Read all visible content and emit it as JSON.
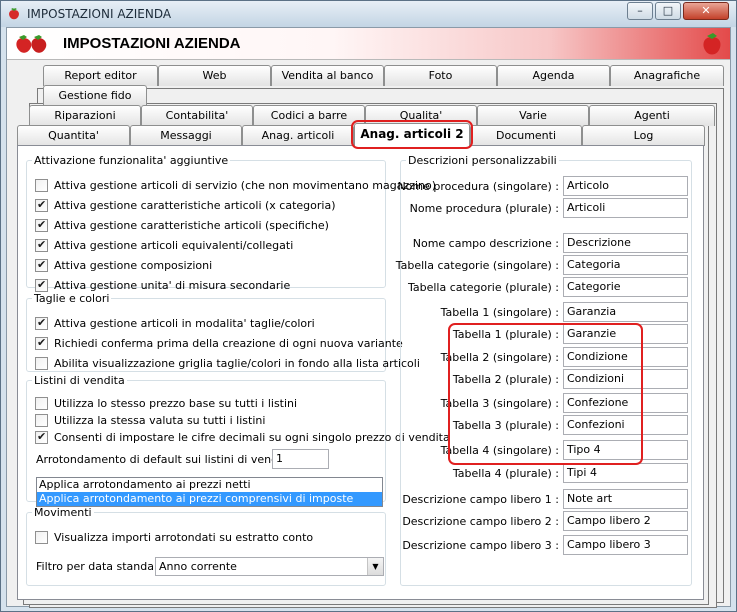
{
  "window": {
    "title": "IMPOSTAZIONI AZIENDA",
    "minimize_glyph": "–",
    "maximize_glyph": "□",
    "close_glyph": "✕"
  },
  "header": {
    "title": "IMPOSTAZIONI AZIENDA",
    "logo_icon": "strawberry-icon"
  },
  "tabs": {
    "row1": [
      "Report editor",
      "Web",
      "Vendita al banco",
      "Foto",
      "Agenda",
      "Anagrafiche"
    ],
    "row2": [
      "Gestione fido"
    ],
    "row3": [
      "Riparazioni",
      "Contabilita'",
      "Codici a barre",
      "Qualita'",
      "Varie",
      "Agenti"
    ],
    "row4": [
      "Quantita'",
      "Messaggi",
      "Anag. articoli",
      "Anag. articoli 2",
      "Documenti",
      "Log"
    ],
    "active": "Anag. articoli 2"
  },
  "attivazione": {
    "legend": "Attivazione funzionalita' aggiuntive",
    "items": [
      {
        "label": "Attiva gestione articoli di servizio (che non movimentano magazzino)",
        "checked": false
      },
      {
        "label": "Attiva gestione caratteristiche articoli (x categoria)",
        "checked": true
      },
      {
        "label": "Attiva gestione caratteristiche articoli (specifiche)",
        "checked": true
      },
      {
        "label": "Attiva gestione articoli equivalenti/collegati",
        "checked": true
      },
      {
        "label": "Attiva gestione composizioni",
        "checked": true
      },
      {
        "label": "Attiva gestione unita' di misura secondarie",
        "checked": true
      }
    ]
  },
  "taglie": {
    "legend": "Taglie e colori",
    "items": [
      {
        "label": "Attiva gestione articoli in modalita' taglie/colori",
        "checked": true
      },
      {
        "label": "Richiedi conferma prima della creazione di ogni nuova variante",
        "checked": true
      },
      {
        "label": "Abilita visualizzazione griglia taglie/colori in fondo alla lista articoli",
        "checked": false
      }
    ]
  },
  "listini": {
    "legend": "Listini di vendita",
    "items": [
      {
        "label": "Utilizza lo stesso prezzo base su tutti i listini",
        "checked": false
      },
      {
        "label": "Utilizza la stessa valuta su tutti i listini",
        "checked": false
      },
      {
        "label": "Consenti di impostare le cifre decimali su ogni singolo prezzo di vendita",
        "checked": true
      }
    ],
    "arrot_label": "Arrotondamento di default sui listini di vendita :",
    "arrot_value": "1",
    "options": [
      "Applica arrotondamento ai prezzi netti",
      "Applica arrotondamento ai prezzi comprensivi di imposte"
    ],
    "selected_index": 1
  },
  "movimenti": {
    "legend": "Movimenti",
    "items": [
      {
        "label": "Visualizza importi arrotondati su estratto conto",
        "checked": false
      }
    ],
    "filtro_label": "Filtro per data standard :",
    "filtro_value": "Anno corrente"
  },
  "descrizioni": {
    "legend": "Descrizioni personalizzabili",
    "fields": [
      {
        "label": "Nome procedura (singolare) :",
        "value": "Articolo"
      },
      {
        "label": "Nome procedura (plurale) :",
        "value": "Articoli"
      },
      {
        "label": "Nome campo descrizione :",
        "value": "Descrizione"
      },
      {
        "label": "Tabella categorie (singolare) :",
        "value": "Categoria"
      },
      {
        "label": "Tabella categorie (plurale) :",
        "value": "Categorie"
      },
      {
        "label": "Tabella 1 (singolare) :",
        "value": "Garanzia"
      },
      {
        "label": "Tabella 1 (plurale) :",
        "value": "Garanzie"
      },
      {
        "label": "Tabella 2 (singolare) :",
        "value": "Condizione"
      },
      {
        "label": "Tabella 2 (plurale) :",
        "value": "Condizioni"
      },
      {
        "label": "Tabella 3 (singolare) :",
        "value": "Confezione"
      },
      {
        "label": "Tabella 3 (plurale) :",
        "value": "Confezioni"
      },
      {
        "label": "Tabella 4 (singolare) :",
        "value": "Tipo 4"
      },
      {
        "label": "Tabella 4 (plurale) :",
        "value": "Tipi 4"
      },
      {
        "label": "Descrizione campo libero 1 :",
        "value": "Note art"
      },
      {
        "label": "Descrizione campo libero 2 :",
        "value": "Campo libero 2"
      },
      {
        "label": "Descrizione campo libero 3 :",
        "value": "Campo libero 3"
      }
    ]
  },
  "colors": {
    "highlight": "#e02020",
    "selection": "#3399ff",
    "banner_red": "#e34a4a"
  }
}
